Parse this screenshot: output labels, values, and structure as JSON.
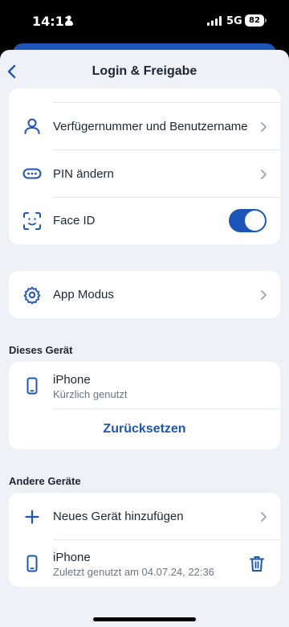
{
  "status_bar": {
    "time": "14:11",
    "network": "5G",
    "battery": "82"
  },
  "nav": {
    "title": "Login & Freigabe"
  },
  "security_card": {
    "items": [
      {
        "label": "Verfügernummer und Benutzername",
        "icon": "person-icon"
      },
      {
        "label": "PIN ändern",
        "icon": "pin-dots-icon"
      },
      {
        "label": "Face ID",
        "icon": "face-id-icon",
        "toggle_on": true
      }
    ]
  },
  "app_mode_card": {
    "label": "App Modus",
    "icon": "gear-icon"
  },
  "this_device": {
    "header": "Dieses Gerät",
    "device_name": "iPhone",
    "device_status": "Kürzlich genutzt",
    "reset_label": "Zurücksetzen"
  },
  "other_devices": {
    "header": "Andere Geräte",
    "add_label": "Neues Gerät hinzufügen",
    "device_name": "iPhone",
    "device_status": "Zuletzt genutzt am 04.07.24, 22:36"
  },
  "colors": {
    "accent": "#1d56b8",
    "background": "#eef1f5",
    "card": "#ffffff"
  }
}
